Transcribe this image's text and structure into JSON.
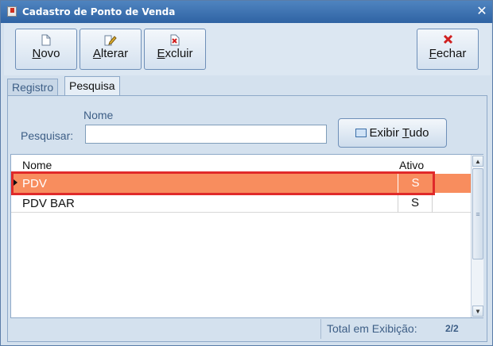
{
  "window": {
    "title": "Cadastro de Ponto de Venda",
    "close_glyph": "✕"
  },
  "toolbar": {
    "novo": {
      "accel": "N",
      "rest": "ovo",
      "icon": "new-document-icon"
    },
    "alterar": {
      "accel": "A",
      "rest": "lterar",
      "icon": "edit-icon"
    },
    "excluir": {
      "accel": "E",
      "rest": "xcluir",
      "icon": "delete-icon"
    },
    "fechar": {
      "accel": "F",
      "rest": "echar",
      "icon": "close-x-icon"
    }
  },
  "tabs": [
    {
      "label": "Registro",
      "active": false
    },
    {
      "label": "Pesquisa",
      "active": true
    }
  ],
  "search": {
    "field_label": "Nome",
    "prefix_label": "Pesquisar:",
    "value": "",
    "button_pre": "Exibir ",
    "button_accel": "T",
    "button_post": "udo"
  },
  "grid": {
    "columns": [
      "Nome",
      "Ativo"
    ],
    "rows": [
      {
        "nome": "PDV",
        "ativo": "S",
        "selected": true
      },
      {
        "nome": "PDV BAR",
        "ativo": "S",
        "selected": false
      }
    ]
  },
  "footer": {
    "total_label": "Total em Exibição:",
    "count": "2/2"
  },
  "colors": {
    "selected_row": "#f88d5e",
    "highlight_frame": "#e02a2a",
    "title_bar": "#2f63a3"
  }
}
